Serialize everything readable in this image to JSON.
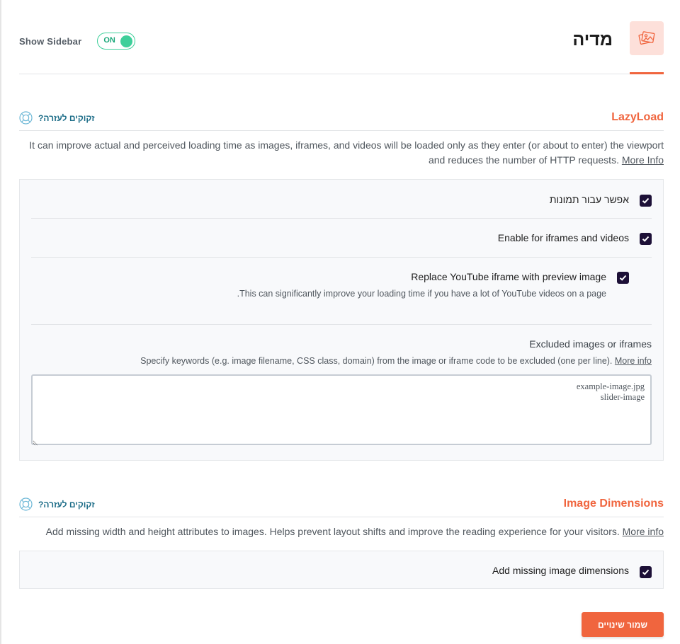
{
  "header": {
    "show_sidebar_label": "Show Sidebar",
    "toggle_state": "ON",
    "page_title": "מדיה",
    "page_icon": "images-icon"
  },
  "colors": {
    "accent": "#f0653e",
    "toggle_on": "#3ecf9a",
    "checkbox": "#1d1037",
    "help_link": "#1b6c87"
  },
  "lazyload": {
    "title": "LazyLoad",
    "help_label": "זקוקים לעזרה?",
    "help_icon": "life-ring-icon",
    "description_line1": "It can improve actual and perceived loading time as images, iframes, and videos will be loaded only as they enter (or about to enter) the viewport",
    "description_line2": "and reduces the number of HTTP requests.",
    "more_info": "More Info",
    "options": [
      {
        "label": "אפשר עבור תמונות",
        "checked": true
      },
      {
        "label": "Enable for iframes and videos",
        "checked": true
      },
      {
        "label": "Replace YouTube iframe with preview image",
        "checked": true,
        "description": ".This can significantly improve your loading time if you have a lot of YouTube videos on a page"
      }
    ],
    "excluded": {
      "label": "Excluded images or iframes",
      "description": "Specify keywords (e.g. image filename, CSS class, domain) from the image or iframe code to be excluded (one per line).",
      "more_info": "More info",
      "value": "example-image.jpg\nslider-image"
    }
  },
  "image_dimensions": {
    "title": "Image Dimensions",
    "help_label": "זקוקים לעזרה?",
    "help_icon": "life-ring-icon",
    "description": "Add missing width and height attributes to images. Helps prevent layout shifts and improve the reading experience for your visitors.",
    "more_info": "More info",
    "options": [
      {
        "label": "Add missing image dimensions",
        "checked": true
      }
    ]
  },
  "footer": {
    "save_label": "שמור שינויים"
  }
}
